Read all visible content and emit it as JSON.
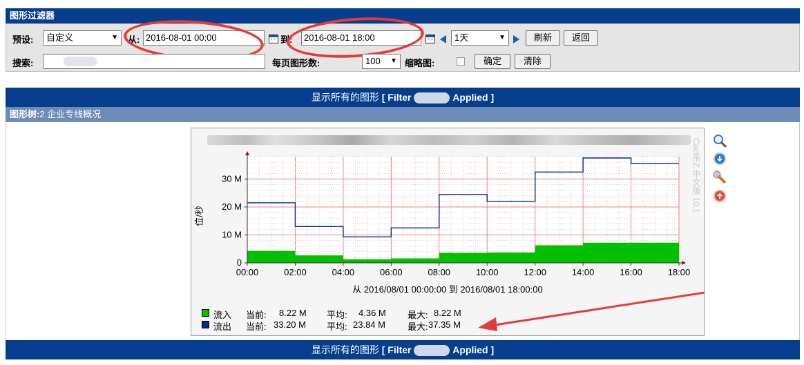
{
  "filter": {
    "title": "图形过滤器",
    "preset_label": "预设:",
    "preset_value": "自定义",
    "from_label": "从:",
    "from_value": "2016-08-01 00:00",
    "to_label": "到:",
    "to_value": "2016-08-01 18:00",
    "span_value": "1天",
    "refresh_label": "刷新",
    "back_label": "返回",
    "search_label": "搜索:",
    "search_value": "",
    "per_page_label": "每页图形数:",
    "per_page_value": "100",
    "thumbnail_label": "缩略图:",
    "thumbnail_checked": false,
    "confirm_label": "确定",
    "clear_label": "清除"
  },
  "header_bar": {
    "show_all_text": "显示所有的图形",
    "filter_prefix": "[ Filter",
    "filter_suffix": "Applied ]"
  },
  "tree": {
    "label": "图形树:",
    "path": "2.企业专线概况"
  },
  "graph": {
    "watermark": "CactiEZ 中文版 10.1",
    "date_range": "从 2016/08/01 00:00:00 到 2016/08/01 18:00:00",
    "legend": [
      {
        "name": "流入",
        "color": "#00c000",
        "current_label": "当前:",
        "current": "8.22 M",
        "avg_label": "平均:",
        "avg": "4.36 M",
        "max_label": "最大:",
        "max": "8.22 M"
      },
      {
        "name": "流出",
        "color": "#002a97",
        "current_label": "当前:",
        "current": "33.20 M",
        "avg_label": "平均:",
        "avg": "23.84 M",
        "max_label": "最大:",
        "max": "37.35 M"
      }
    ],
    "side_icons": [
      "zoom-icon",
      "download-icon",
      "edit-icon",
      "delete-icon"
    ]
  },
  "chart_data": {
    "type": "area",
    "ylabel": "位/秒",
    "ylim": [
      0,
      38
    ],
    "yticks": [
      0,
      10,
      20,
      30
    ],
    "ytick_labels": [
      "0",
      "10 M",
      "20 M",
      "30 M"
    ],
    "xlim": [
      0,
      18
    ],
    "xticks": [
      0,
      2,
      4,
      6,
      8,
      10,
      12,
      14,
      16,
      18
    ],
    "xtick_labels": [
      "00:00",
      "02:00",
      "04:00",
      "06:00",
      "08:00",
      "10:00",
      "12:00",
      "14:00",
      "16:00",
      "18:00"
    ],
    "grid": true,
    "series": [
      {
        "name": "流入",
        "style": "area",
        "color": "#00c000",
        "x": [
          0,
          2,
          2,
          4,
          4,
          6,
          6,
          8,
          8,
          10,
          10,
          12,
          12,
          14,
          14,
          18
        ],
        "y": [
          4.3,
          4.3,
          2.7,
          2.7,
          1.3,
          1.3,
          1.6,
          1.6,
          3.6,
          3.6,
          3.7,
          3.7,
          6.3,
          6.3,
          7.2,
          7.2
        ]
      },
      {
        "name": "流出",
        "style": "line",
        "color": "#002a97",
        "x": [
          0,
          2,
          2,
          4,
          4,
          6,
          6,
          8,
          8,
          10,
          10,
          12,
          12,
          14,
          14,
          16,
          16,
          18
        ],
        "y": [
          21.5,
          21.5,
          13.0,
          13.0,
          9.3,
          9.3,
          12.5,
          12.5,
          24.5,
          24.5,
          22.0,
          22.0,
          32.5,
          32.5,
          37.5,
          37.5,
          35.5,
          35.5
        ]
      }
    ]
  }
}
